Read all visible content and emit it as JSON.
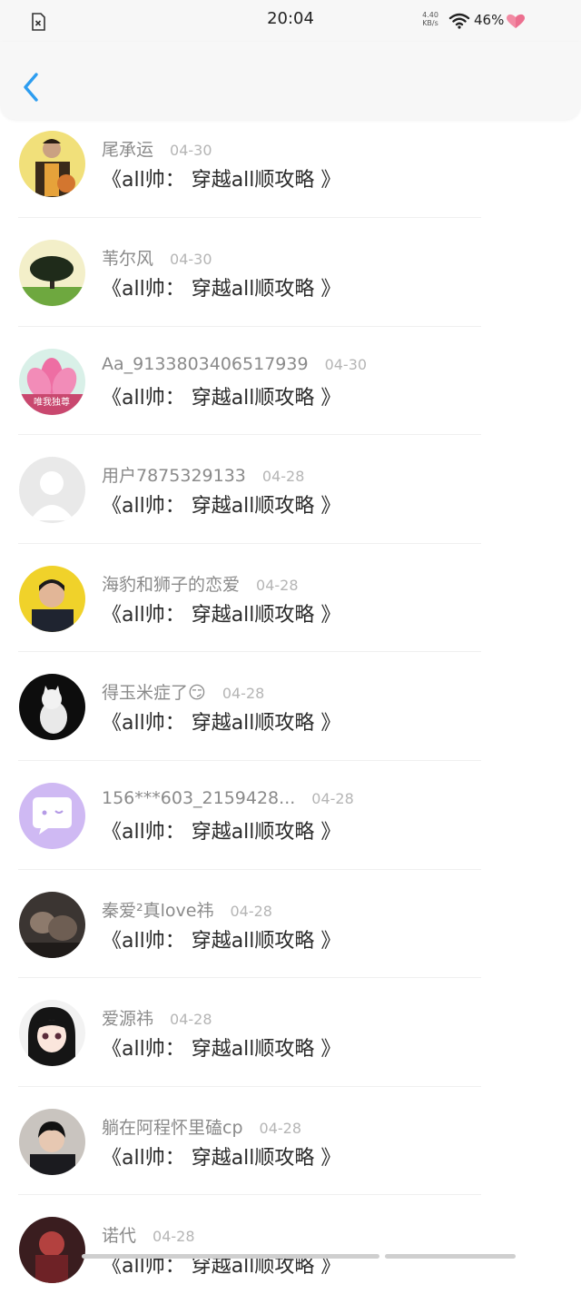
{
  "status_bar": {
    "time": "20:04",
    "net_speed_value": "4.40",
    "net_speed_unit": "KB/s",
    "battery": "46%"
  },
  "header": {
    "back_icon": "chevron-left-icon",
    "accent_color": "#2d9df0"
  },
  "items": [
    {
      "username": "尾承运",
      "date": "04-30",
      "title": "《all帅： 穿越all顺攻略 》",
      "avatar": "basketball-player"
    },
    {
      "username": "苇尔风",
      "date": "04-30",
      "title": "《all帅： 穿越all顺攻略 》",
      "avatar": "tree"
    },
    {
      "username": "Aa_9133803406517939",
      "date": "04-30",
      "title": "《all帅： 穿越all顺攻略 》",
      "avatar": "lotus",
      "avatar_text": "唯我独尊"
    },
    {
      "username": "用户7875329133",
      "date": "04-28",
      "title": "《all帅： 穿越all顺攻略 》",
      "avatar": "default-person"
    },
    {
      "username": "海豹和狮子的恋爱",
      "date": "04-28",
      "title": "《all帅： 穿越all顺攻略 》",
      "avatar": "young-man-yellow"
    },
    {
      "username": "得玉米症了😏",
      "date": "04-28",
      "title": "《all帅： 穿越all顺攻略 》",
      "avatar": "white-cat"
    },
    {
      "username": "156***603_2159428...",
      "date": "04-28",
      "title": "《all帅： 穿越all顺攻略 》",
      "avatar": "chat-bubble"
    },
    {
      "username": "秦爱²真love祎",
      "date": "04-28",
      "title": "《all帅： 穿越all顺攻略 》",
      "avatar": "dark-photo"
    },
    {
      "username": "爱源祎",
      "date": "04-28",
      "title": "《all帅： 穿越all顺攻略 》",
      "avatar": "anime-girl"
    },
    {
      "username": "躺在阿程怀里磕cp",
      "date": "04-28",
      "title": "《all帅： 穿越all顺攻略 》",
      "avatar": "young-man-dark"
    },
    {
      "username": "诺代",
      "date": "04-28",
      "title": "《all帅： 穿越all顺攻略 》",
      "avatar": "game-character"
    }
  ]
}
